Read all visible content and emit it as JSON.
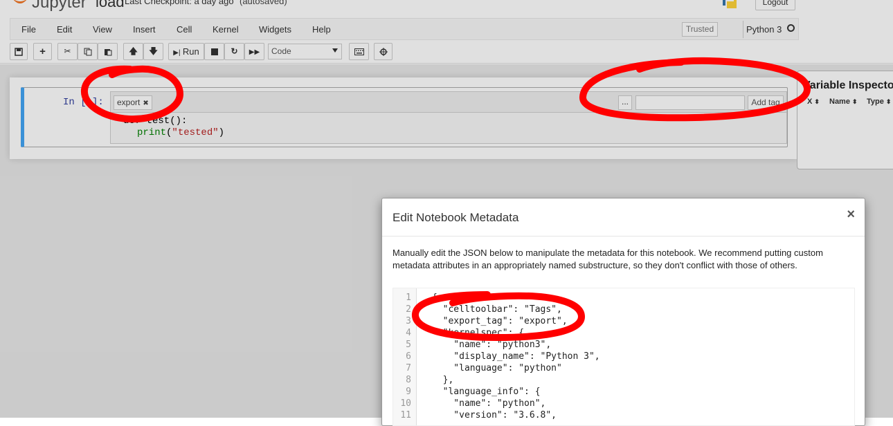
{
  "header": {
    "logo_text": "Jupyter",
    "notebook_name": "load",
    "checkpoint": "Last Checkpoint: a day ago",
    "autosave": "(autosaved)",
    "logout_label": "Logout"
  },
  "menubar": {
    "items": [
      "File",
      "Edit",
      "View",
      "Insert",
      "Cell",
      "Kernel",
      "Widgets",
      "Help"
    ],
    "trusted_label": "Trusted",
    "kernel_name": "Python 3"
  },
  "toolbar": {
    "run_label": "Run",
    "cell_type": "Code"
  },
  "cell": {
    "prompt": "In [ ]:",
    "tag": "export",
    "dots_label": "...",
    "add_tag_label": "Add tag",
    "code_line1": "def test():",
    "code_line2_func": "print",
    "code_line2_open": "(",
    "code_line2_str": "\"tested\"",
    "code_line2_close": ")"
  },
  "variable_inspector": {
    "title": "Variable Inspector",
    "col_x": "X",
    "col_name": "Name",
    "col_type": "Type"
  },
  "modal": {
    "title": "Edit Notebook Metadata",
    "close_symbol": "×",
    "description": "Manually edit the JSON below to manipulate the metadata for this notebook. We recommend putting custom metadata attributes in an appropriately named substructure, so they don't conflict with those of others.",
    "json_lines": [
      "{",
      "  \"celltoolbar\": \"Tags\",",
      "  \"export_tag\": \"export\",",
      "  \"kernelspec\": {",
      "    \"name\": \"python3\",",
      "    \"display_name\": \"Python 3\",",
      "    \"language\": \"python\"",
      "  },",
      "  \"language_info\": {",
      "    \"name\": \"python\",",
      "    \"version\": \"3.6.8\","
    ],
    "line_numbers": [
      "1",
      "2",
      "3",
      "4",
      "5",
      "6",
      "7",
      "8",
      "9",
      "10",
      "11"
    ]
  },
  "colors": {
    "annotation_red": "#ff0000",
    "cell_selected_border": "#42a5f5",
    "prompt_blue": "#303f9f"
  }
}
